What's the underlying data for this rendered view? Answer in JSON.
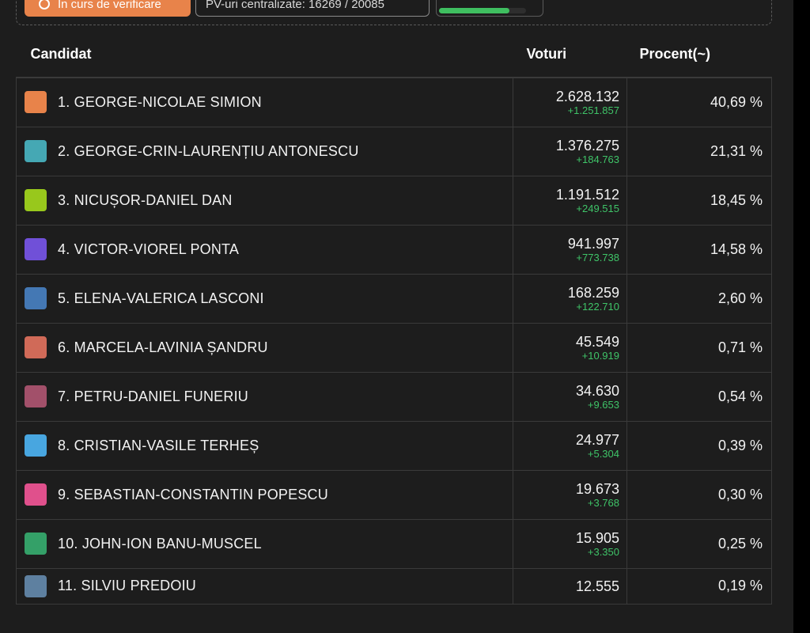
{
  "status_bar": {
    "status_label": "În curs de verificare",
    "status_icon": "gear-icon",
    "pv_label": "PV-uri centralizate: 16269 / 20085",
    "progress": 0.81
  },
  "table": {
    "headers": {
      "candidate": "Candidat",
      "votes": "Voturi",
      "percent": "Procent(~)"
    },
    "rows": [
      {
        "name": "1. GEORGE-NICOLAE SIMION",
        "color": "#e8834a",
        "votes": "2.628.132",
        "delta": "+1.251.857",
        "percent": "40,69 %"
      },
      {
        "name": "2. GEORGE-CRIN-LAURENȚIU ANTONESCU",
        "color": "#45a8b4",
        "votes": "1.376.275",
        "delta": "+184.763",
        "percent": "21,31 %"
      },
      {
        "name": "3. NICUȘOR-DANIEL DAN",
        "color": "#98c81c",
        "votes": "1.191.512",
        "delta": "+249.515",
        "percent": "18,45 %"
      },
      {
        "name": "4. VICTOR-VIOREL PONTA",
        "color": "#7050d8",
        "votes": "941.997",
        "delta": "+773.738",
        "percent": "14,58 %"
      },
      {
        "name": "5. ELENA-VALERICA LASCONI",
        "color": "#4478b4",
        "votes": "168.259",
        "delta": "+122.710",
        "percent": "2,60 %"
      },
      {
        "name": "6. MARCELA-LAVINIA ȘANDRU",
        "color": "#d06a58",
        "votes": "45.549",
        "delta": "+10.919",
        "percent": "0,71 %"
      },
      {
        "name": "7. PETRU-DANIEL FUNERIU",
        "color": "#a2506a",
        "votes": "34.630",
        "delta": "+9.653",
        "percent": "0,54 %"
      },
      {
        "name": "8. CRISTIAN-VASILE TERHEȘ",
        "color": "#48a6e0",
        "votes": "24.977",
        "delta": "+5.304",
        "percent": "0,39 %"
      },
      {
        "name": "9. SEBASTIAN-CONSTANTIN POPESCU",
        "color": "#e0508c",
        "votes": "19.673",
        "delta": "+3.768",
        "percent": "0,30 %"
      },
      {
        "name": "10. JOHN-ION BANU-MUSCEL",
        "color": "#34a068",
        "votes": "15.905",
        "delta": "+3.350",
        "percent": "0,25 %"
      },
      {
        "name": "11. SILVIU PREDOIU",
        "color": "#5e80a0",
        "votes": "12.555",
        "delta": "",
        "percent": "0,19 %"
      }
    ]
  }
}
